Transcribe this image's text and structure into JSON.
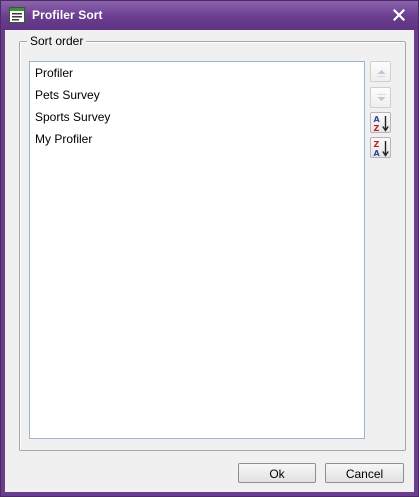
{
  "window": {
    "title": "Profiler Sort",
    "title_icon": "list-window-icon",
    "close_icon": "close-icon",
    "accent_color": "#6a3d8f"
  },
  "sort_group": {
    "legend": "Sort order",
    "items": [
      "Profiler",
      "Pets Survey",
      "Sports Survey",
      "My Profiler"
    ]
  },
  "side_buttons": {
    "move_up": {
      "icon": "move-up-icon",
      "enabled": false
    },
    "move_down": {
      "icon": "move-down-icon",
      "enabled": false
    },
    "sort_ascending": {
      "icon": "sort-a-z-icon",
      "enabled": true
    },
    "sort_descending": {
      "icon": "sort-z-a-icon",
      "enabled": true
    }
  },
  "footer": {
    "ok_label": "Ok",
    "cancel_label": "Cancel"
  }
}
